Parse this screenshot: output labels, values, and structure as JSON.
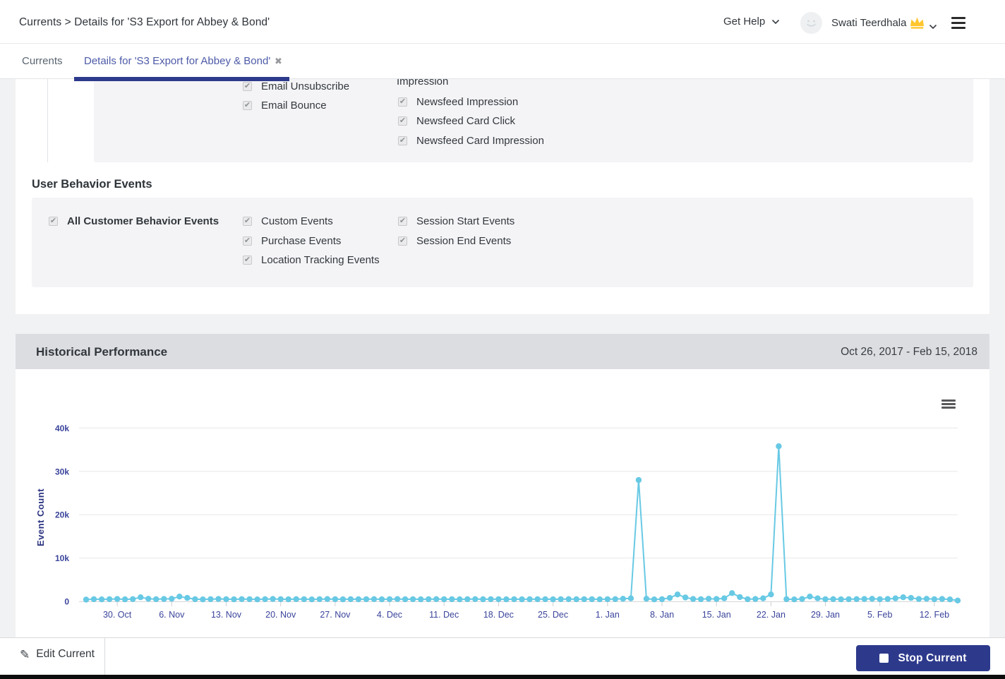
{
  "header": {
    "breadcrumb": "Currents > Details for 'S3 Export for Abbey & Bond'",
    "get_help_label": "Get Help",
    "user_name": "Swati Teerdhala"
  },
  "tabs": {
    "tab_currents": "Currents",
    "tab_details": "Details for 'S3 Export for Abbey & Bond'"
  },
  "icons": {
    "check_glyph": "✔",
    "close_glyph": "✖",
    "pencil_glyph": "✎"
  },
  "message_events_panel": {
    "clipped_fragment": "Impression",
    "col1": [
      "Email Unsubscribe",
      "Email Bounce"
    ],
    "col2": [
      "Newsfeed Impression",
      "Newsfeed Card Click",
      "Newsfeed Card Impression"
    ]
  },
  "user_behavior": {
    "heading": "User Behavior Events",
    "col1": [
      "All Customer Behavior Events"
    ],
    "col2": [
      "Custom Events",
      "Purchase Events",
      "Location Tracking Events"
    ],
    "col3": [
      "Session Start Events",
      "Session End Events"
    ]
  },
  "historical": {
    "title": "Historical Performance",
    "date_range": "Oct 26, 2017 - Feb 15, 2018"
  },
  "footer": {
    "edit_label": "Edit Current",
    "stop_label": "Stop Current"
  },
  "colors": {
    "accent_navy": "#2d3a8c",
    "chart_line": "#68c9e4",
    "axis_text": "#3a449b",
    "axis_title": "#2b3480",
    "grid": "#e7e7e9"
  },
  "chart_data": {
    "type": "line",
    "ylabel": "Event Count",
    "start_date": "Oct 26, 2017",
    "end_date": "Feb 15, 2018",
    "interval": "daily",
    "ylim": [
      0,
      42000
    ],
    "grid": true,
    "legend": false,
    "line_color": "#68c9e4",
    "y_ticks": [
      "0",
      "10k",
      "20k",
      "30k",
      "40k"
    ],
    "x_tick_labels": [
      "30. Oct",
      "6. Nov",
      "13. Nov",
      "20. Nov",
      "27. Nov",
      "4. Dec",
      "11. Dec",
      "18. Dec",
      "25. Dec",
      "1. Jan",
      "8. Jan",
      "15. Jan",
      "22. Jan",
      "29. Jan",
      "5. Feb",
      "12. Feb"
    ],
    "x_tick_indices": [
      4,
      11,
      18,
      25,
      32,
      39,
      46,
      53,
      60,
      67,
      74,
      81,
      88,
      95,
      102,
      109
    ],
    "values": [
      400,
      500,
      450,
      500,
      550,
      480,
      520,
      950,
      600,
      500,
      550,
      600,
      1100,
      800,
      500,
      450,
      500,
      550,
      500,
      480,
      520,
      500,
      450,
      500,
      550,
      500,
      480,
      520,
      500,
      460,
      500,
      540,
      500,
      480,
      510,
      490,
      500,
      520,
      480,
      500,
      530,
      490,
      510,
      470,
      500,
      520,
      490,
      510,
      480,
      500,
      520,
      490,
      500,
      510,
      480,
      500,
      470,
      490,
      510,
      500,
      480,
      500,
      520,
      490,
      500,
      510,
      480,
      500,
      520,
      600,
      700,
      28000,
      600,
      450,
      500,
      800,
      1600,
      900,
      550,
      500,
      600,
      550,
      700,
      1900,
      1000,
      500,
      550,
      700,
      1600,
      35800,
      500,
      450,
      550,
      1100,
      700,
      500,
      520,
      480,
      500,
      520,
      550,
      600,
      500,
      550,
      700,
      950,
      800,
      550,
      600,
      500,
      550,
      450,
      200
    ]
  }
}
